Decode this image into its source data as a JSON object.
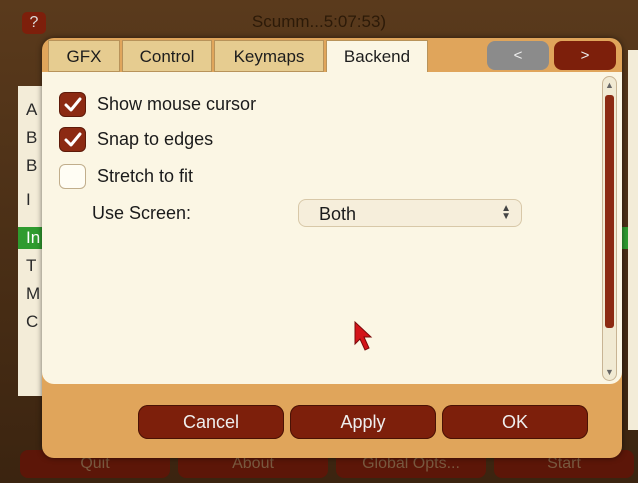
{
  "background": {
    "title": "Scumm...5:07:53)",
    "help_label": "?",
    "list_letters": [
      "A",
      "B",
      "B",
      "I",
      "In",
      "T",
      "M",
      "C"
    ],
    "bottom_buttons": [
      "Quit",
      "About",
      "Global Opts...",
      "Start"
    ]
  },
  "dialog": {
    "tabs": [
      {
        "label": "GFX",
        "active": false
      },
      {
        "label": "Control",
        "active": false
      },
      {
        "label": "Keymaps",
        "active": false
      },
      {
        "label": "Backend",
        "active": true
      }
    ],
    "nav": {
      "prev_label": "<",
      "next_label": ">"
    },
    "options": [
      {
        "label": "Show mouse cursor",
        "checked": true
      },
      {
        "label": "Snap to edges",
        "checked": true
      },
      {
        "label": "Stretch to fit",
        "checked": false
      }
    ],
    "use_screen": {
      "label": "Use Screen:",
      "value": "Both"
    },
    "buttons": {
      "cancel": "Cancel",
      "apply": "Apply",
      "ok": "OK"
    }
  },
  "colors": {
    "accent": "#7d1f0b",
    "dialog_frame": "#e0a55b",
    "panel": "#fbf6e4",
    "highlight": "#2f9b2f",
    "cursor": "#d4141a"
  },
  "icons": [
    "help-icon",
    "checkmark-icon",
    "select-arrows-icon",
    "scroll-up-icon",
    "scroll-down-icon",
    "mouse-cursor-icon"
  ]
}
